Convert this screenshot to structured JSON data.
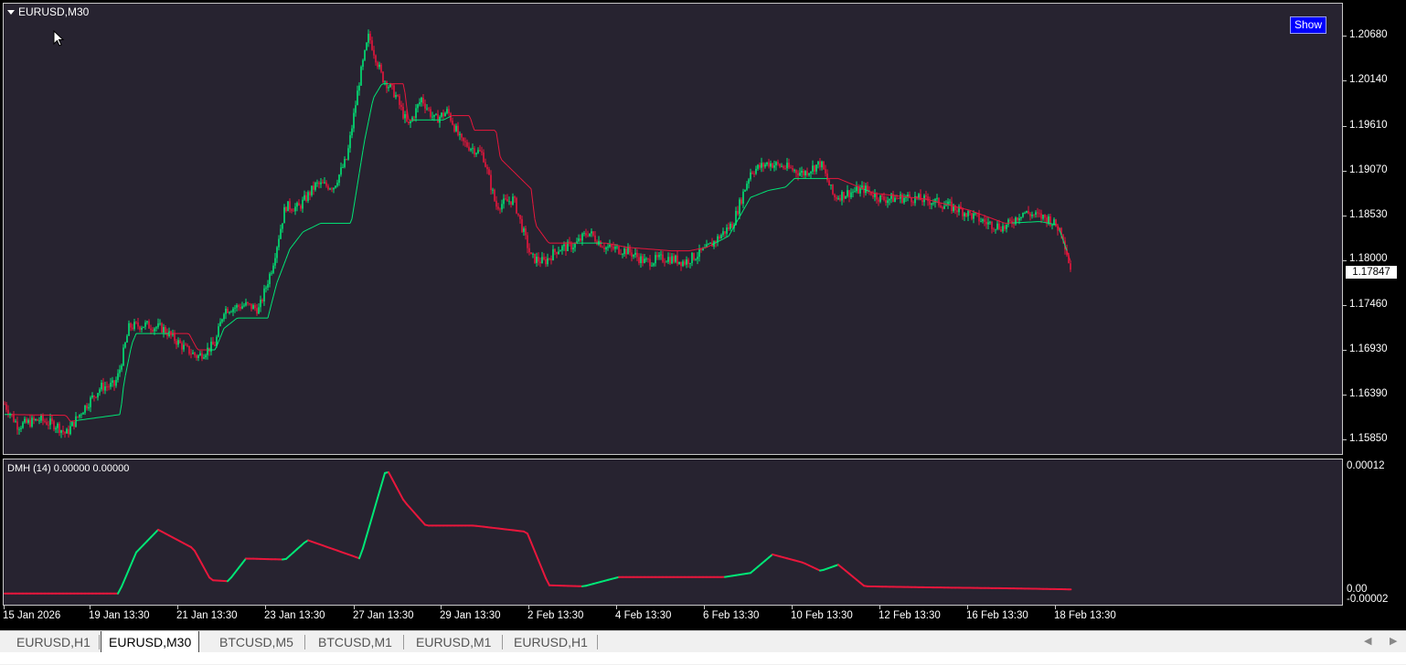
{
  "chart_window": {
    "symbol_title": "EURUSD,M30",
    "show_button": "Show",
    "current_price": "1.17847",
    "price_axis": [
      "1.20680",
      "1.20140",
      "1.19610",
      "1.19070",
      "1.18530",
      "1.18000",
      "1.17460",
      "1.16930",
      "1.16390",
      "1.15850"
    ],
    "time_axis": [
      "15 Jan 2026",
      "19 Jan 13:30",
      "21 Jan 13:30",
      "23 Jan 13:30",
      "27 Jan 13:30",
      "29 Jan 13:30",
      "2 Feb 13:30",
      "4 Feb 13:30",
      "6 Feb 13:30",
      "10 Feb 13:30",
      "12 Feb 13:30",
      "16 Feb 13:30",
      "18 Feb 13:30"
    ]
  },
  "indicator_window": {
    "title": "DMH (14) 0.00000 0.00000",
    "axis_top": "0.00012",
    "axis_zero": "0.00",
    "axis_bottom": "-0.00002"
  },
  "tabs": [
    {
      "label": "EURUSD,H1",
      "active": false
    },
    {
      "label": "EURUSD,M30",
      "active": true
    },
    {
      "label": "BTCUSD,M5",
      "active": false
    },
    {
      "label": "BTCUSD,M1",
      "active": false
    },
    {
      "label": "EURUSD,M1",
      "active": false
    },
    {
      "label": "EURUSD,H1",
      "active": false
    }
  ],
  "colors": {
    "background": "#272330",
    "bull": "#00e676",
    "bear": "#e8173c",
    "ma_line": "#e8173c"
  },
  "chart_data": [
    {
      "type": "line",
      "title": "EURUSD,M30",
      "xlabel": "",
      "ylabel": "",
      "ylim": [
        1.157,
        1.2095
      ],
      "x_ticks": [
        "15 Jan 2026",
        "19 Jan 13:30",
        "21 Jan 13:30",
        "23 Jan 13:30",
        "27 Jan 13:30",
        "29 Jan 13:30",
        "2 Feb 13:30",
        "4 Feb 13:30",
        "6 Feb 13:30",
        "10 Feb 13:30",
        "12 Feb 13:30",
        "16 Feb 13:30",
        "18 Feb 13:30"
      ],
      "x_range_index": [
        0,
        12.6
      ],
      "price_path": [
        [
          0.0,
          1.163
        ],
        [
          0.15,
          1.1605
        ],
        [
          0.4,
          1.1612
        ],
        [
          0.6,
          1.1605
        ],
        [
          0.7,
          1.1595
        ],
        [
          0.9,
          1.1625
        ],
        [
          1.1,
          1.165
        ],
        [
          1.25,
          1.1652
        ],
        [
          1.3,
          1.1665
        ],
        [
          1.42,
          1.172
        ],
        [
          1.6,
          1.1722
        ],
        [
          1.8,
          1.1718
        ],
        [
          2.05,
          1.1695
        ],
        [
          2.2,
          1.1685
        ],
        [
          2.4,
          1.17
        ],
        [
          2.5,
          1.174
        ],
        [
          2.75,
          1.1745
        ],
        [
          2.9,
          1.174
        ],
        [
          3.05,
          1.179
        ],
        [
          3.2,
          1.186
        ],
        [
          3.35,
          1.1858
        ],
        [
          3.55,
          1.1885
        ],
        [
          3.75,
          1.1883
        ],
        [
          3.9,
          1.1915
        ],
        [
          4.05,
          1.201
        ],
        [
          4.15,
          1.2058
        ],
        [
          4.3,
          1.201
        ],
        [
          4.45,
          1.199
        ],
        [
          4.6,
          1.1952
        ],
        [
          4.75,
          1.1985
        ],
        [
          4.9,
          1.196
        ],
        [
          5.05,
          1.197
        ],
        [
          5.2,
          1.1935
        ],
        [
          5.45,
          1.192
        ],
        [
          5.6,
          1.186
        ],
        [
          5.8,
          1.1868
        ],
        [
          6.0,
          1.18
        ],
        [
          6.15,
          1.1795
        ],
        [
          6.3,
          1.181
        ],
        [
          6.5,
          1.1815
        ],
        [
          6.65,
          1.183
        ],
        [
          6.85,
          1.1812
        ],
        [
          7.1,
          1.1808
        ],
        [
          7.3,
          1.1795
        ],
        [
          7.55,
          1.18
        ],
        [
          7.75,
          1.1795
        ],
        [
          8.0,
          1.181
        ],
        [
          8.3,
          1.184
        ],
        [
          8.5,
          1.19
        ],
        [
          8.7,
          1.191
        ],
        [
          8.9,
          1.1905
        ],
        [
          9.1,
          1.1898
        ],
        [
          9.3,
          1.191
        ],
        [
          9.45,
          1.187
        ],
        [
          9.6,
          1.1875
        ],
        [
          9.8,
          1.188
        ],
        [
          10.0,
          1.1868
        ],
        [
          10.3,
          1.187
        ],
        [
          10.6,
          1.1865
        ],
        [
          10.9,
          1.1855
        ],
        [
          11.2,
          1.184
        ],
        [
          11.4,
          1.1835
        ],
        [
          11.6,
          1.1853
        ],
        [
          11.9,
          1.1845
        ],
        [
          12.05,
          1.183
        ],
        [
          12.15,
          1.1785
        ]
      ],
      "ma_path": [
        [
          0.0,
          1.1618
        ],
        [
          0.7,
          1.1617
        ],
        [
          0.75,
          1.161
        ],
        [
          1.32,
          1.1618
        ],
        [
          1.36,
          1.1655
        ],
        [
          1.45,
          1.17
        ],
        [
          1.5,
          1.1712
        ],
        [
          2.1,
          1.1712
        ],
        [
          2.2,
          1.1693
        ],
        [
          2.4,
          1.1693
        ],
        [
          2.5,
          1.1718
        ],
        [
          2.65,
          1.173
        ],
        [
          3.0,
          1.173
        ],
        [
          3.1,
          1.177
        ],
        [
          3.25,
          1.181
        ],
        [
          3.4,
          1.183
        ],
        [
          3.6,
          1.184
        ],
        [
          3.95,
          1.184
        ],
        [
          4.1,
          1.1935
        ],
        [
          4.2,
          1.1985
        ],
        [
          4.3,
          1.2002
        ],
        [
          4.55,
          1.2002
        ],
        [
          4.6,
          1.196
        ],
        [
          5.0,
          1.196
        ],
        [
          5.1,
          1.1965
        ],
        [
          5.3,
          1.1965
        ],
        [
          5.35,
          1.1948
        ],
        [
          5.6,
          1.1948
        ],
        [
          5.65,
          1.1915
        ],
        [
          6.0,
          1.188
        ],
        [
          6.05,
          1.1838
        ],
        [
          6.2,
          1.1817
        ],
        [
          6.85,
          1.1817
        ],
        [
          7.1,
          1.1812
        ],
        [
          7.6,
          1.1808
        ],
        [
          7.8,
          1.1808
        ],
        [
          8.0,
          1.1812
        ],
        [
          8.25,
          1.1825
        ],
        [
          8.5,
          1.187
        ],
        [
          8.7,
          1.1878
        ],
        [
          8.9,
          1.1882
        ],
        [
          9.0,
          1.1892
        ],
        [
          9.5,
          1.1892
        ],
        [
          9.9,
          1.1875
        ],
        [
          10.5,
          1.1868
        ],
        [
          11.0,
          1.1855
        ],
        [
          11.4,
          1.184
        ],
        [
          11.8,
          1.1842
        ],
        [
          12.0,
          1.1838
        ],
        [
          12.15,
          1.1795
        ]
      ]
    },
    {
      "type": "line",
      "title": "DMH (14) 0.00000 0.00000",
      "ylim": [
        -2e-05,
        0.00013
      ],
      "series": [
        {
          "values_path": [
            [
              0.0,
              0.0
            ],
            [
              0.8,
              -0.0
            ],
            [
              1.3,
              0.0
            ],
            [
              1.5,
              0.004
            ],
            [
              1.75,
              0.0062
            ],
            [
              2.15,
              0.0044
            ],
            [
              2.35,
              0.0013
            ],
            [
              2.55,
              0.0012
            ],
            [
              2.75,
              0.0034
            ],
            [
              3.2,
              0.0033
            ],
            [
              3.45,
              0.0052
            ],
            [
              4.05,
              0.0034
            ],
            [
              4.35,
              0.0122
            ],
            [
              4.55,
              0.009
            ],
            [
              4.8,
              0.0066
            ],
            [
              5.35,
              0.0066
            ],
            [
              5.95,
              0.006
            ],
            [
              6.2,
              0.0008
            ],
            [
              6.6,
              0.0007
            ],
            [
              7.0,
              0.0016
            ],
            [
              8.2,
              0.0016
            ],
            [
              8.5,
              0.002
            ],
            [
              8.75,
              0.0038
            ],
            [
              9.1,
              0.003
            ],
            [
              9.3,
              0.0022
            ],
            [
              9.5,
              0.0028
            ],
            [
              9.8,
              0.0007
            ],
            [
              10.5,
              0.0006
            ],
            [
              11.5,
              0.0005
            ],
            [
              12.15,
              0.0004
            ]
          ]
        }
      ]
    }
  ]
}
